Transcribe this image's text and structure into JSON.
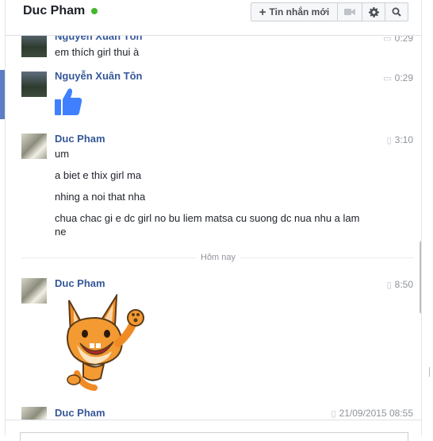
{
  "header": {
    "title": "Duc Pham",
    "new_message_label": "Tin nhắn mới",
    "online_color": "#42b72a",
    "icons": [
      "video-camera-icon",
      "gear-icon",
      "search-icon"
    ]
  },
  "messages": [
    {
      "sender": "Nguyễn Xuân Tôn",
      "time": "0:29",
      "time_icon": "chat-icon",
      "lines": [
        "em thích girl thui à"
      ]
    },
    {
      "sender": "Nguyễn Xuân Tôn",
      "time": "0:29",
      "time_icon": "chat-icon",
      "content": "thumbs-up-icon"
    },
    {
      "sender": "Duc Pham",
      "time": "3:10",
      "time_icon": "mobile-icon",
      "lines": [
        "um",
        "a biet e thix girl ma",
        "nhing a noi that nha",
        "chua chac gi e dc girl no bu liem matsa cu suong dc nua nhu a lam ne"
      ]
    },
    {
      "sender": "Duc Pham",
      "time": "8:50",
      "time_icon": "mobile-icon",
      "content": "fox-sticker"
    },
    {
      "sender": "Duc Pham",
      "time": "21/09/2015 08:55",
      "time_icon": "mobile-icon"
    }
  ],
  "divider": {
    "label": "Hôm nay"
  },
  "colors": {
    "name": "#365899",
    "accent": "#5b7ec4",
    "thumb": "#4080ff"
  }
}
